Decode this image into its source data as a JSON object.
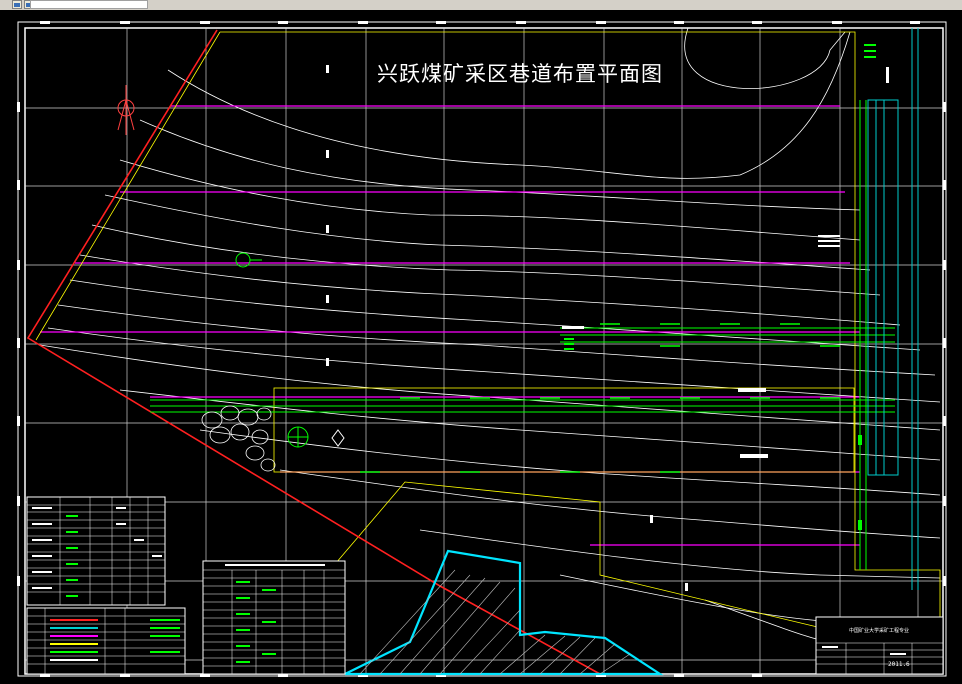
{
  "window": {
    "toolbar_icons": [
      "restore-icon",
      "drawing-file-icon"
    ]
  },
  "drawing": {
    "title": "兴跃煤矿采区巷道布置平面图",
    "title_block": {
      "caption": "中国矿业大学采矿工程专业",
      "sheet_no": "2011.6"
    },
    "colors": {
      "background": "#000000",
      "frame": "#ffffff",
      "grid": "#e6e6e6",
      "contour": "#ffffff",
      "magenta_line": "#ff00ff",
      "roadway": "#00ff00",
      "boundary": "#ffff00",
      "fault": "#ff0000",
      "goaf": "#00e5ff",
      "shaft": "#00cccc"
    }
  }
}
